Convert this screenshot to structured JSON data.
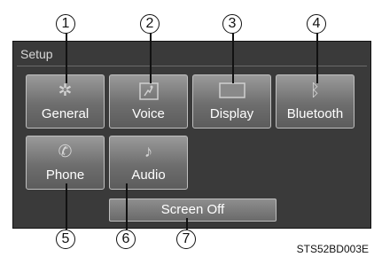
{
  "screen": {
    "title": "Setup",
    "tiles": [
      {
        "label": "General",
        "icon": "gear-icon",
        "glyph": "✲"
      },
      {
        "label": "Voice",
        "icon": "voice-icon",
        "glyph": "🗣"
      },
      {
        "label": "Display",
        "icon": "display-icon",
        "glyph": ""
      },
      {
        "label": "Bluetooth",
        "icon": "bluetooth-icon",
        "glyph": "ᛒ"
      },
      {
        "label": "Phone",
        "icon": "phone-icon",
        "glyph": "✆"
      },
      {
        "label": "Audio",
        "icon": "music-note-icon",
        "glyph": "♪"
      }
    ],
    "screen_off_label": "Screen Off"
  },
  "callouts": [
    "1",
    "2",
    "3",
    "4",
    "5",
    "6",
    "7"
  ],
  "caption": "STS52BD003E"
}
